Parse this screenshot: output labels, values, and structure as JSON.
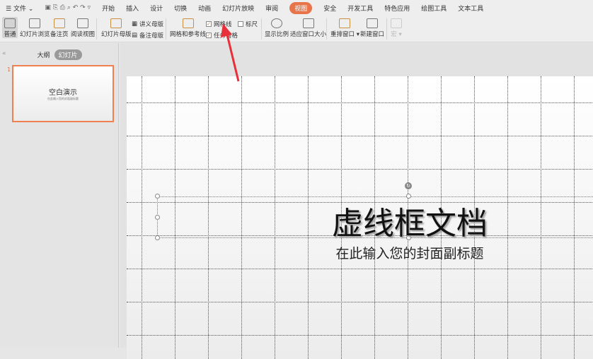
{
  "menu": {
    "file": "文件",
    "items": [
      "开始",
      "插入",
      "设计",
      "切换",
      "动画",
      "幻灯片放映",
      "审阅",
      "视图",
      "安全",
      "开发工具",
      "特色应用",
      "绘图工具",
      "文本工具"
    ],
    "active": "视图"
  },
  "ribbon": {
    "normal": "普通",
    "sorter": "幻灯片浏览",
    "notes_page": "备注页",
    "reading": "阅读视图",
    "slide_master": "幻灯片母版",
    "handout_master": "讲义母版",
    "notes_master": "备注母版",
    "grid_guides": "网格和参考线",
    "gridlines": "网格线",
    "ruler": "标尺",
    "task_pane": "任务窗格",
    "zoom": "显示比例",
    "fit": "适应窗口大小",
    "arrange": "重排窗口",
    "new_window": "新建窗口",
    "macro": "宏"
  },
  "checks": {
    "gridlines": true,
    "ruler": false,
    "task_pane": true
  },
  "sidebar": {
    "outline_tab": "大纲",
    "slides_tab": "幻灯片",
    "slide_number": "1",
    "thumb_title": "空白演示",
    "thumb_subtitle": "在此输入您的封面副标题"
  },
  "slide": {
    "title": "虚线框文档",
    "subtitle": "在此输入您的封面副标题"
  },
  "colors": {
    "accent": "#e8744a",
    "arrow": "#e8303a"
  }
}
